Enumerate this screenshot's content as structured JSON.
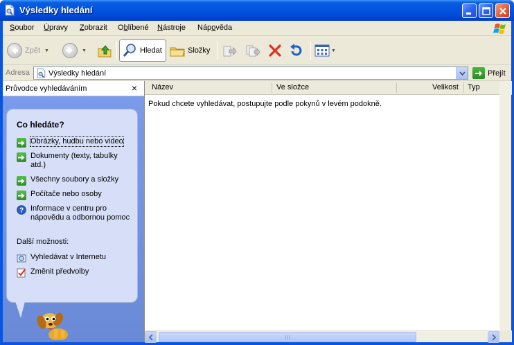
{
  "window": {
    "title": "Výsledky hledání",
    "titlebar_color": "#0054e3"
  },
  "menu": {
    "items": [
      {
        "pre": "",
        "acc": "S",
        "post": "oubor"
      },
      {
        "pre": "",
        "acc": "Ú",
        "post": "pravy"
      },
      {
        "pre": "",
        "acc": "Z",
        "post": "obrazit"
      },
      {
        "pre": "O",
        "acc": "b",
        "post": "líbené"
      },
      {
        "pre": "",
        "acc": "N",
        "post": "ástroje"
      },
      {
        "pre": "Náp",
        "acc": "o",
        "post": "věda"
      }
    ]
  },
  "toolbar": {
    "back_label": "Zpět",
    "search_label": "Hledat",
    "folders_label": "Složky"
  },
  "address": {
    "label": "Adresa",
    "value": "Výsledky hledání",
    "go_label": "Přejít"
  },
  "leftpane": {
    "title": "Průvodce vyhledáváním",
    "close_glyph": "×",
    "question": "Co hledáte?",
    "options": [
      "Obrázky, hudbu nebo video",
      "Dokumenty (texty, tabulky atd.)",
      "Všechny soubory a složky",
      "Počítače nebo osoby",
      "Informace v centru pro nápovědu a odbornou pomoc"
    ],
    "more_label": "Další možnosti:",
    "more_options": [
      "Vyhledávat v Internetu",
      "Změnit předvolby"
    ]
  },
  "results": {
    "columns": [
      "Název",
      "Ve složce",
      "Velikost",
      "Typ"
    ],
    "message": "Pokud chcete vyhledávat, postupujte podle pokynů v levém podokně."
  }
}
